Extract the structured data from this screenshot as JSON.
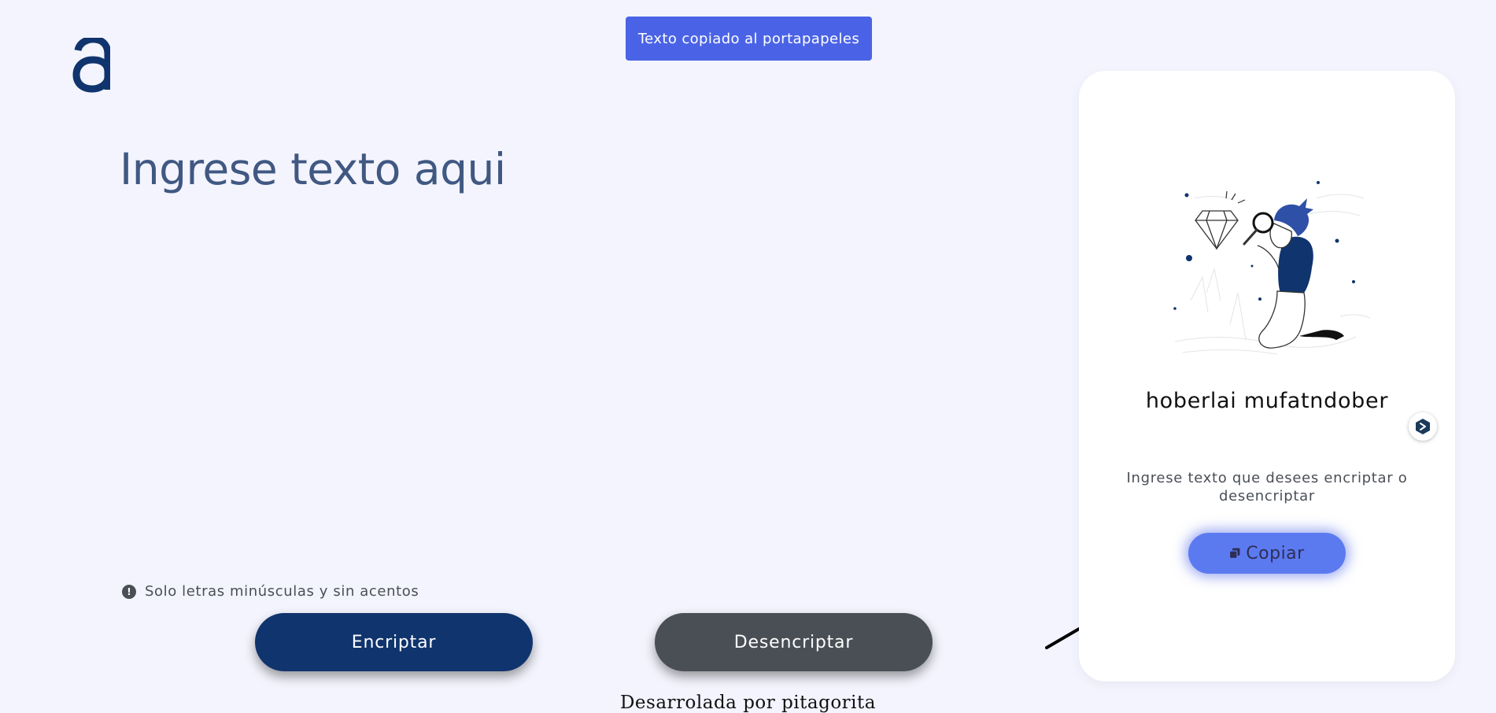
{
  "toast": {
    "message": "Texto copiado al portapapeles"
  },
  "editor": {
    "placeholder": "Ingrese texto aqui"
  },
  "hint": {
    "text": "Solo letras minúsculas y sin acentos",
    "icon": "exclamation-circle-icon"
  },
  "buttons": {
    "encrypt_label": "Encriptar",
    "decrypt_label": "Desencriptar"
  },
  "footer": {
    "text": "Desarrolada por pitagorita"
  },
  "output": {
    "result_text": "hoberlai mufatndober",
    "instructions": "Ingrese texto que desees encriptar o desencriptar",
    "copy_label": "Copiar",
    "copy_icon": "copy-icon",
    "illustration": "person-with-magnifier-and-diamond"
  },
  "colors": {
    "background": "#f3f4fd",
    "toast": "#4a63e6",
    "encrypt_button": "#10346d",
    "decrypt_button": "#4a4f56",
    "copy_button": "#5c7af0",
    "placeholder_text": "#405882"
  }
}
